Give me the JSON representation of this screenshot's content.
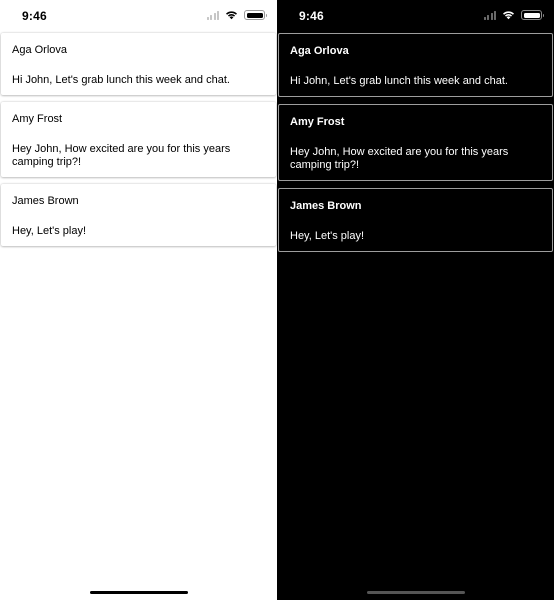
{
  "light": {
    "status": {
      "time": "9:46"
    },
    "messages": [
      {
        "name": "Aga Orlova",
        "text": " Hi John, Let's grab lunch this week and chat."
      },
      {
        "name": "Amy Frost",
        "text": " Hey John, How excited are you for this years camping trip?!"
      },
      {
        "name": "James Brown",
        "text": " Hey, Let's play!"
      }
    ]
  },
  "dark": {
    "status": {
      "time": "9:46"
    },
    "messages": [
      {
        "name": "Aga Orlova",
        "text": " Hi John, Let's grab lunch this week and chat."
      },
      {
        "name": "Amy Frost",
        "text": " Hey John, How excited are you for this years camping trip?!"
      },
      {
        "name": "James Brown",
        "text": " Hey, Let's play!"
      }
    ]
  },
  "icons": {
    "signal": "cellular-signal-icon",
    "wifi": "wifi-icon",
    "battery": "battery-icon"
  },
  "colors": {
    "light_background": "#ffffff",
    "dark_background": "#000000",
    "dark_card_border": "#9d9d9d"
  }
}
